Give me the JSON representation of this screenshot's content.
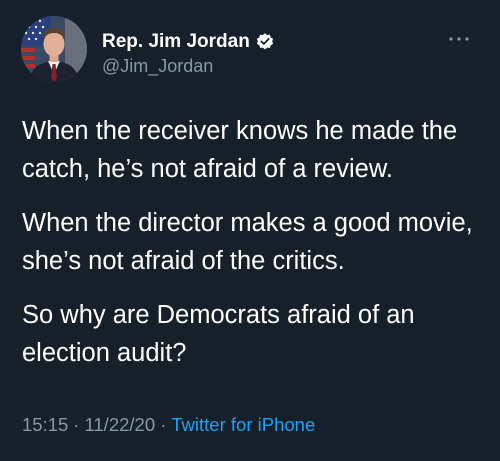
{
  "tweet": {
    "display_name": "Rep. Jim Jordan",
    "handle": "@Jim_Jordan",
    "verified": true,
    "paragraphs": [
      "When the receiver knows he made the catch, he’s not afraid of a review.",
      "When the director makes a good movie, she’s not afraid of the critics.",
      "So why are Democrats afraid of an election audit?"
    ],
    "time": "15:15",
    "date": "11/22/20",
    "separator": "·",
    "source": "Twitter for iPhone"
  },
  "icons": {
    "verified": "verified-badge-icon",
    "more": "more-options-icon"
  },
  "colors": {
    "background": "#15202b",
    "text": "#ffffff",
    "secondary_text": "#8899a6",
    "link": "#1da1f2"
  }
}
